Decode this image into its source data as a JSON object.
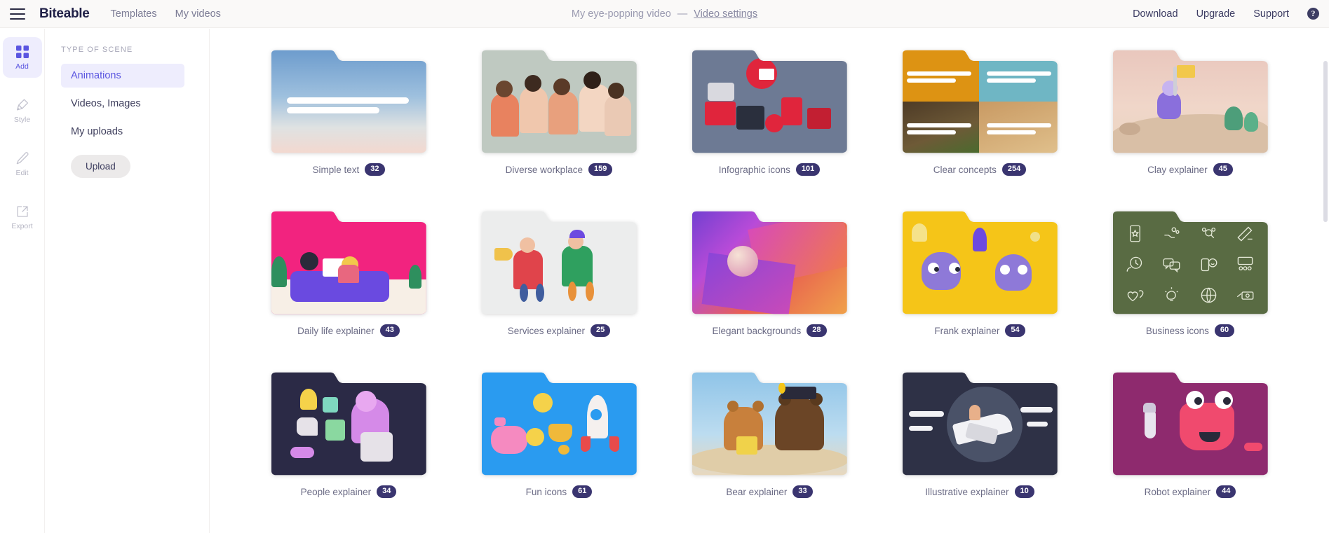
{
  "topbar": {
    "menu_icon": "hamburger-icon",
    "brand": "Biteable",
    "nav": [
      {
        "label": "Templates"
      },
      {
        "label": "My videos"
      }
    ],
    "video_title": "My eye-popping video",
    "separator": "—",
    "video_settings": "Video settings",
    "right_links": [
      {
        "label": "Download"
      },
      {
        "label": "Upgrade"
      },
      {
        "label": "Support"
      }
    ],
    "help_icon": "help-circle-icon",
    "help_glyph": "?"
  },
  "rail": {
    "items": [
      {
        "label": "Add",
        "icon": "grid-add-icon",
        "active": true
      },
      {
        "label": "Style",
        "icon": "paint-roller-icon",
        "active": false
      },
      {
        "label": "Edit",
        "icon": "pencil-icon",
        "active": false
      },
      {
        "label": "Export",
        "icon": "export-icon",
        "active": false
      }
    ]
  },
  "sidebar": {
    "heading": "TYPE OF SCENE",
    "items": [
      {
        "label": "Animations",
        "active": true
      },
      {
        "label": "Videos, Images",
        "active": false
      },
      {
        "label": "My uploads",
        "active": false
      }
    ],
    "upload_button": "Upload"
  },
  "colors": {
    "accent": "#5a55e0",
    "accent_bg": "#eeedfd",
    "badge_bg": "#3a3570",
    "brand_text": "#1f1f46",
    "topbar_bg": "#faf9f8",
    "caption_text": "#6b6b85"
  },
  "grid": {
    "cards": [
      {
        "label": "Simple text",
        "count": "32",
        "style": "simple-text"
      },
      {
        "label": "Diverse workplace",
        "count": "159",
        "style": "diverse-workplace"
      },
      {
        "label": "Infographic icons",
        "count": "101",
        "style": "infographic-icons"
      },
      {
        "label": "Clear concepts",
        "count": "254",
        "style": "clear-concepts"
      },
      {
        "label": "Clay explainer",
        "count": "45",
        "style": "clay-explainer"
      },
      {
        "label": "Daily life explainer",
        "count": "43",
        "style": "daily-life"
      },
      {
        "label": "Services explainer",
        "count": "25",
        "style": "services"
      },
      {
        "label": "Elegant backgrounds",
        "count": "28",
        "style": "elegant-bg"
      },
      {
        "label": "Frank explainer",
        "count": "54",
        "style": "frank"
      },
      {
        "label": "Business icons",
        "count": "60",
        "style": "business-icons"
      },
      {
        "label": "People explainer",
        "count": "34",
        "style": "people"
      },
      {
        "label": "Fun icons",
        "count": "61",
        "style": "fun-icons"
      },
      {
        "label": "Bear explainer",
        "count": "33",
        "style": "bear"
      },
      {
        "label": "Illustrative explainer",
        "count": "10",
        "style": "illustrative"
      },
      {
        "label": "Robot explainer",
        "count": "44",
        "style": "robot"
      }
    ]
  }
}
